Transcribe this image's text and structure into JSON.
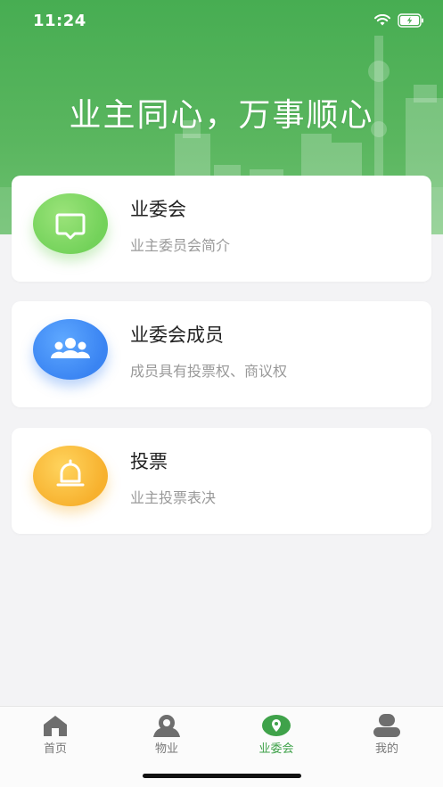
{
  "status": {
    "time": "11:24",
    "wifi_icon": "wifi-icon",
    "battery_icon": "battery-charging-icon"
  },
  "hero": {
    "title": "业主同心，万事顺心"
  },
  "cards": [
    {
      "title": "业委会",
      "subtitle": "业主委员会简介",
      "icon": "message-icon",
      "color": "#73d25a"
    },
    {
      "title": "业委会成员",
      "subtitle": "成员具有投票权、商议权",
      "icon": "group-icon",
      "color": "#3a84f2"
    },
    {
      "title": "投票",
      "subtitle": "业主投票表决",
      "icon": "bell-icon",
      "color": "#f7b12e"
    }
  ],
  "tabbar": {
    "items": [
      {
        "label": "首页",
        "icon": "home-icon"
      },
      {
        "label": "物业",
        "icon": "property-icon"
      },
      {
        "label": "业委会",
        "icon": "committee-location-icon",
        "active": true
      },
      {
        "label": "我的",
        "icon": "profile-icon"
      }
    ],
    "active_color": "#3fa24a"
  }
}
